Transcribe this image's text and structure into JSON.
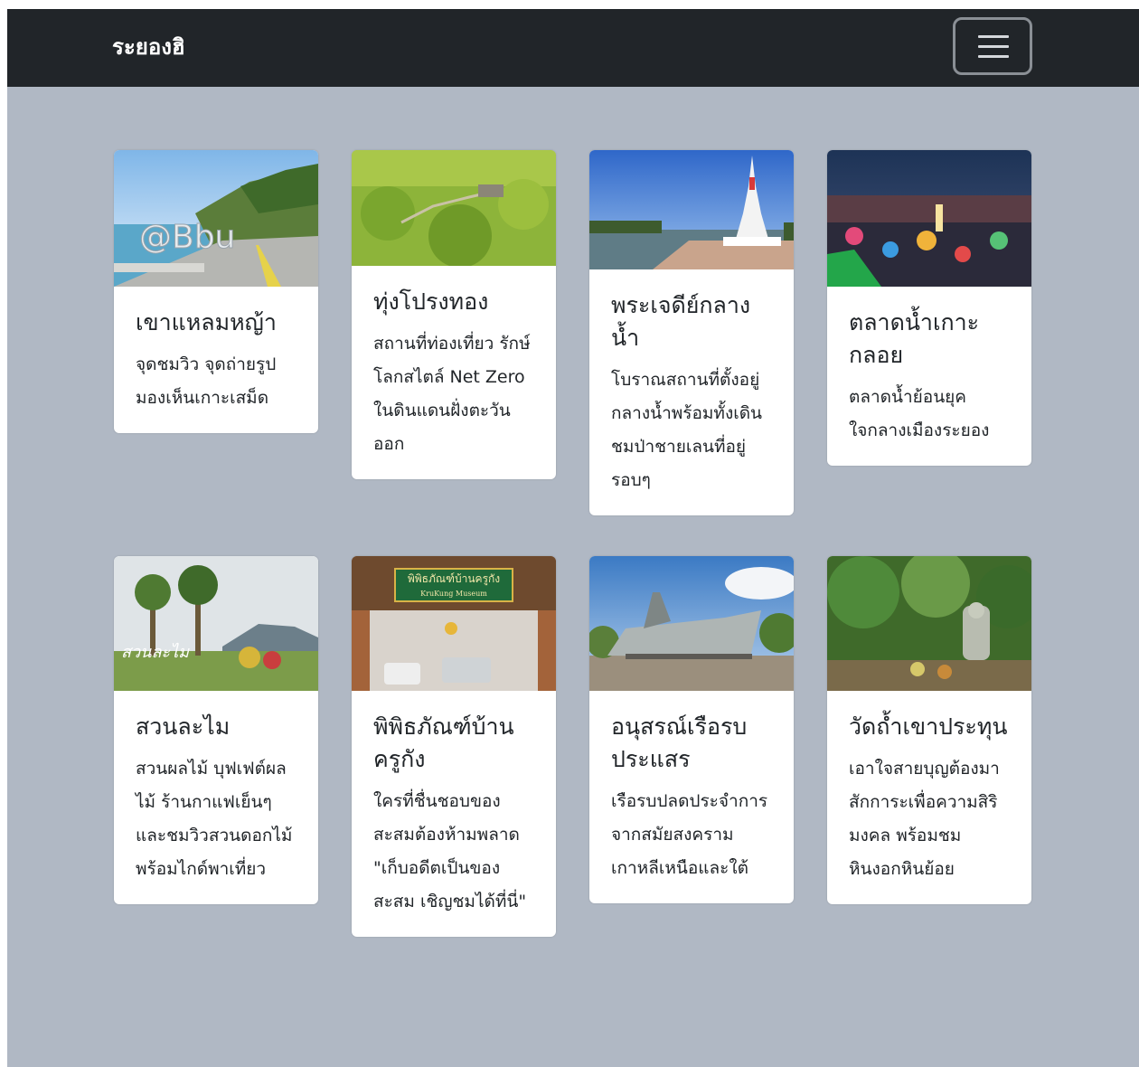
{
  "navbar": {
    "brand": "ระยองฮิ",
    "toggler_icon": "hamburger-menu-icon"
  },
  "cards": [
    {
      "title": "เขาแหลมหญ้า",
      "text": "จุดชมวิว จุดถ่ายรูป มองเห็นเกาะเสม็ด",
      "image": "coastal-road-landmark-image"
    },
    {
      "title": "ทุ่งโปรงทอง",
      "text": "สถานที่ท่องเที่ยว รักษ์โลกสไตล์ Net Zero ในดินแดนฝั่งตะวันออก",
      "image": "mangrove-forest-image"
    },
    {
      "title": "พระเจดีย์กลางน้ำ",
      "text": "โบราณสถานที่ตั้งอยู่กลางน้ำพร้อมทั้งเดินชมป่าชายเลนที่อยู่รอบๆ",
      "image": "white-pagoda-image"
    },
    {
      "title": "ตลาดน้ำเกาะกลอย",
      "text": "ตลาดน้ำย้อนยุค ใจกลางเมืองระยอง",
      "image": "night-market-image"
    },
    {
      "title": "สวนละไม",
      "text": "สวนผลไม้ บุฟเฟต์ผลไม้ ร้านกาแฟเย็นๆ และชมวิวสวนดอกไม้พร้อมไกด์พาเที่ยว",
      "image": "garden-sign-image"
    },
    {
      "title": "พิพิธภัณฑ์บ้านครูกัง",
      "text": "ใครที่ชื่นชอบของสะสมต้องห้ามพลาด \"เก็บอดีตเป็นของสะสม เชิญชมได้ที่นี่\"",
      "image": "museum-entrance-image",
      "sign_lines": [
        "พิพิธภัณฑ์บ้านครูกัง",
        "KruKung Museum"
      ]
    },
    {
      "title": "อนุสรณ์เรือรบประแสร",
      "text": "เรือรบปลดประจำการจากสมัยสงครามเกาหลีเหนือและใต้",
      "image": "warship-memorial-image"
    },
    {
      "title": "วัดถ้ำเขาประทุน",
      "text": "เอาใจสายบุญต้องมาสักการะเพื่อความสิริมงคล พร้อมชมหินงอกหินย้อย",
      "image": "temple-cave-image"
    }
  ]
}
